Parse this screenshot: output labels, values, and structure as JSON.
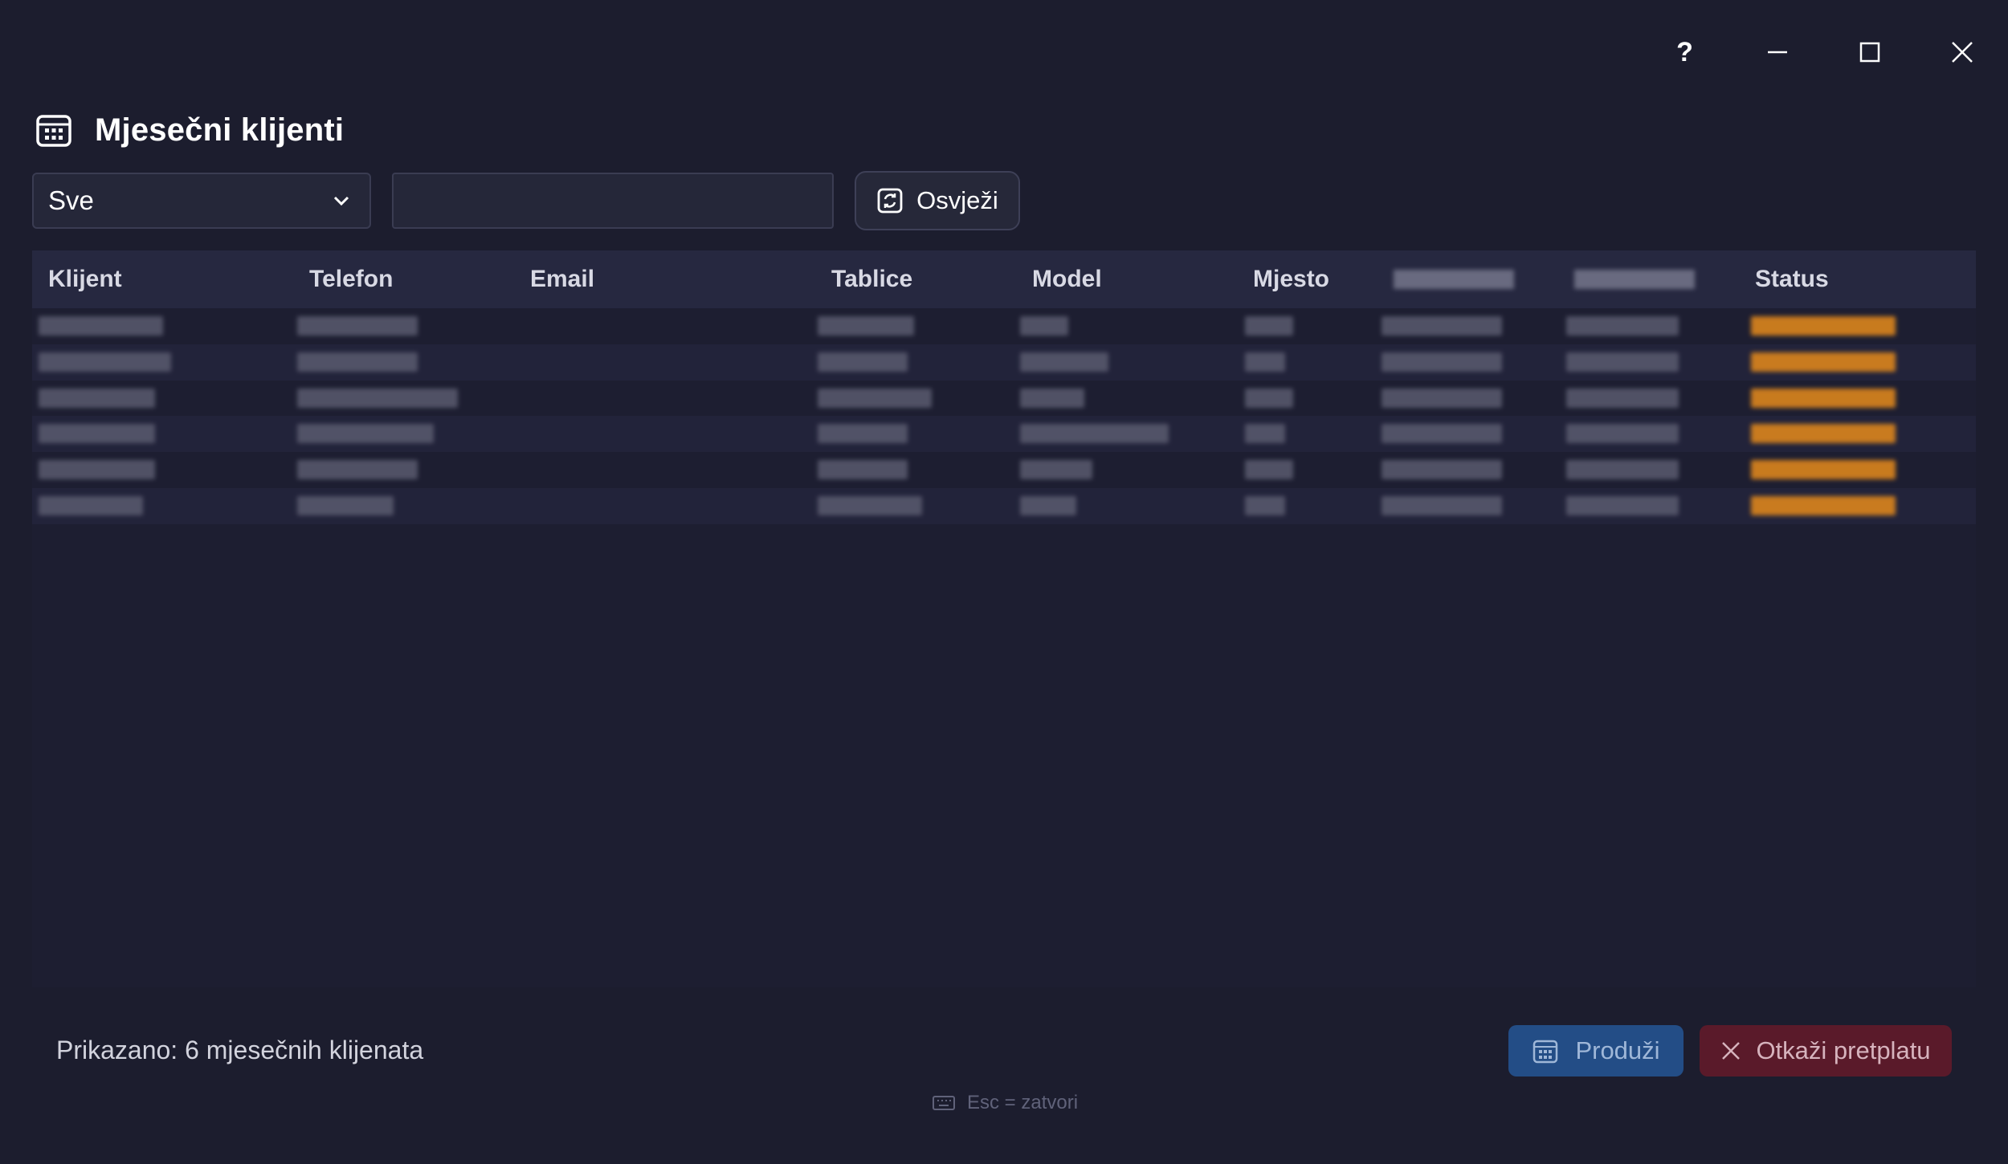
{
  "window": {
    "help_label": "?",
    "icons": [
      "question-icon",
      "minimize-icon",
      "maximize-icon",
      "close-icon"
    ]
  },
  "header": {
    "title": "Mjesečni klijenti",
    "icon": "calendar-icon"
  },
  "toolbar": {
    "filter_selected": "Sve",
    "search_value": "",
    "refresh_label": "Osvježi"
  },
  "table": {
    "columns": [
      "Klijent",
      "Telefon",
      "Email",
      "Tablice",
      "Model",
      "Mjesto",
      "",
      "",
      "Status"
    ],
    "rows": [
      {
        "klijent": "",
        "telefon": "",
        "email": "",
        "tablice": "",
        "model": "",
        "mjesto": "",
        "od": "",
        "do": "",
        "status": ""
      },
      {
        "klijent": "",
        "telefon": "",
        "email": "",
        "tablice": "",
        "model": "",
        "mjesto": "",
        "od": "",
        "do": "",
        "status": ""
      },
      {
        "klijent": "",
        "telefon": "",
        "email": "",
        "tablice": "",
        "model": "",
        "mjesto": "",
        "od": "",
        "do": "",
        "status": ""
      },
      {
        "klijent": "",
        "telefon": "",
        "email": "",
        "tablice": "",
        "model": "",
        "mjesto": "",
        "od": "",
        "do": "",
        "status": ""
      },
      {
        "klijent": "",
        "telefon": "",
        "email": "",
        "tablice": "",
        "model": "",
        "mjesto": "",
        "od": "",
        "do": "",
        "status": ""
      },
      {
        "klijent": "",
        "telefon": "",
        "email": "",
        "tablice": "",
        "model": "",
        "mjesto": "",
        "od": "",
        "do": "",
        "status": ""
      }
    ]
  },
  "footer": {
    "count_text": "Prikazano: 6 mjesečnih klijenata",
    "extend_label": "Produži",
    "cancel_label": "Otkaži pretplatu",
    "hint": "Esc = zatvori"
  },
  "colors": {
    "background": "#1c1d2e",
    "extend_button": "#234d86",
    "cancel_button": "#5a1a2a",
    "status_accent": "#d2801e"
  }
}
